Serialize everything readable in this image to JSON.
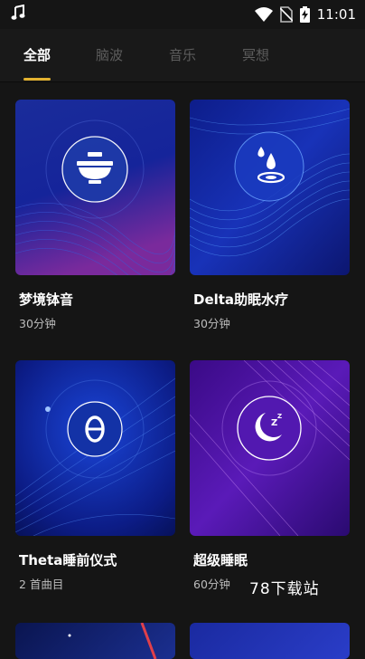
{
  "status": {
    "time": "11:01"
  },
  "tabs": [
    {
      "label": "全部"
    },
    {
      "label": "脑波"
    },
    {
      "label": "音乐"
    },
    {
      "label": "冥想"
    }
  ],
  "cards": [
    {
      "title": "梦境钵音",
      "subtitle": "30分钟",
      "icon": "singing-bowl-icon"
    },
    {
      "title": "Delta助眠水疗",
      "subtitle": "30分钟",
      "icon": "water-drop-icon"
    },
    {
      "title": "Theta睡前仪式",
      "subtitle": "2 首曲目",
      "icon": "theta-icon"
    },
    {
      "title": "超级睡眠",
      "subtitle": "60分钟",
      "icon": "moon-zzz-icon"
    }
  ],
  "watermark": "78下载站",
  "colors": {
    "accent": "#e3b230",
    "background": "#151515"
  }
}
